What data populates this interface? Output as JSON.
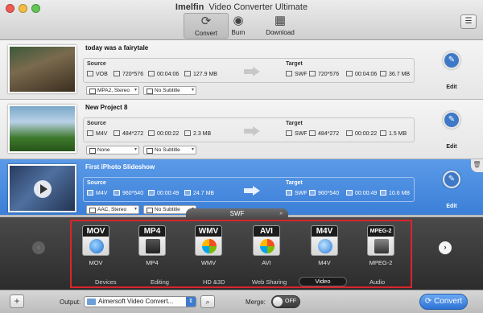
{
  "window": {
    "title_brand": "Imelfin",
    "title_app": "Video Converter Ultimate"
  },
  "toolbar": {
    "tools": [
      {
        "label": "Convert",
        "icon": "convert-icon",
        "active": true
      },
      {
        "label": "Burn",
        "icon": "burn-icon",
        "active": false
      },
      {
        "label": "Download",
        "icon": "download-icon",
        "active": false
      }
    ]
  },
  "items": [
    {
      "title": "today was a fairytale",
      "source_label": "Source",
      "target_label": "Target",
      "source": {
        "format": "VOB",
        "resolution": "720*576",
        "duration": "00:04:06",
        "size": "127.9 MB"
      },
      "target": {
        "format": "SWF",
        "resolution": "720*576",
        "duration": "00:04:06",
        "size": "36.7 MB"
      },
      "audio": "MPA2, Stereo",
      "subtitle": "No Subtitle",
      "edit_label": "Edit"
    },
    {
      "title": "New Project 8",
      "source_label": "Source",
      "target_label": "Target",
      "source": {
        "format": "M4V",
        "resolution": "484*272",
        "duration": "00:00:22",
        "size": "2.3 MB"
      },
      "target": {
        "format": "SWF",
        "resolution": "484*272",
        "duration": "00:00:22",
        "size": "1.5 MB"
      },
      "audio": "None",
      "subtitle": "No Subtitle",
      "edit_label": "Edit"
    },
    {
      "title": "First iPhoto Slideshow",
      "source_label": "Source",
      "target_label": "Target",
      "source": {
        "format": "M4V",
        "resolution": "960*540",
        "duration": "00:00:49",
        "size": "24.7 MB"
      },
      "target": {
        "format": "SWF",
        "resolution": "960*540",
        "duration": "00:00:49",
        "size": "10.6 MB"
      },
      "audio": "AAC, Stereo",
      "subtitle": "No Subtitle",
      "edit_label": "Edit"
    }
  ],
  "format_panel": {
    "current": "SWF",
    "formats": [
      {
        "tag": "MOV",
        "name": "MOV",
        "icon": "quicktime-icon"
      },
      {
        "tag": "MP4",
        "name": "MP4",
        "icon": "mp4-icon"
      },
      {
        "tag": "WMV",
        "name": "WMV",
        "icon": "windows-media-icon"
      },
      {
        "tag": "AVI",
        "name": "AVI",
        "icon": "avi-icon"
      },
      {
        "tag": "M4V",
        "name": "M4V",
        "icon": "itunes-icon"
      },
      {
        "tag": "MPEG-2",
        "name": "MPEG-2",
        "icon": "mpeg2-icon"
      }
    ],
    "categories": [
      "Devices",
      "Editing",
      "HD &3D",
      "Web Sharing",
      "Video",
      "Audio"
    ],
    "selected_category": "Video"
  },
  "footer": {
    "output_label": "Output:",
    "output_value": "Aimersoft Video Convert...",
    "merge_label": "Merge:",
    "merge_state": "OFF",
    "convert_label": "Convert"
  },
  "colors": {
    "selection": "#3b7fd7",
    "accent": "#2d72d4",
    "highlight_border": "#d9252b"
  }
}
